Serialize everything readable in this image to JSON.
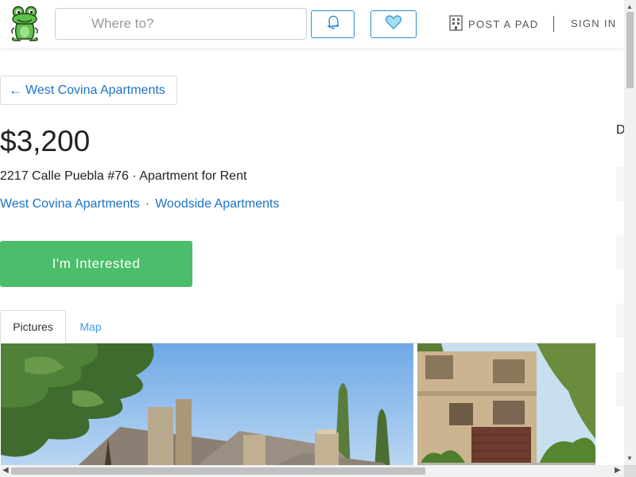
{
  "header": {
    "search_placeholder": "Where to?",
    "search_value": "",
    "post_pad_label": "POST A PAD",
    "sign_in_label": "SIGN IN",
    "icons": [
      "frog-logo-icon",
      "bell-icon",
      "heart-icon",
      "building-icon"
    ]
  },
  "listing": {
    "back_label": "West Covina Apartments",
    "price": "$3,200",
    "address_line": "2217 Calle Puebla #76 · Apartment for Rent",
    "links": [
      {
        "label": "West Covina Apartments"
      },
      {
        "label": "Woodside Apartments"
      }
    ],
    "separator": "·",
    "interested_label": "I'm Interested"
  },
  "tabs": [
    {
      "label": "Pictures",
      "active": true
    },
    {
      "label": "Map",
      "active": false
    }
  ],
  "right_column": {
    "cut_text": "D"
  },
  "colors": {
    "accent_blue": "#1a73c8",
    "button_green": "#4cbd6a",
    "tab_link_blue": "#3aa0e0",
    "icon_button_border": "#2b8fd8"
  }
}
